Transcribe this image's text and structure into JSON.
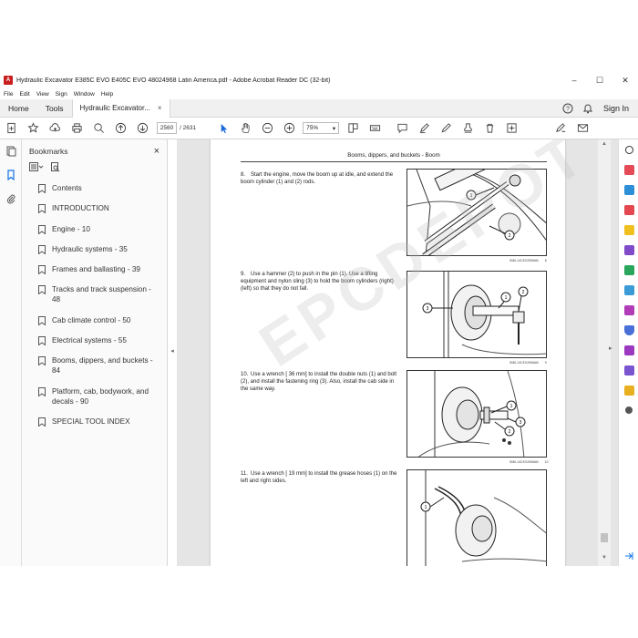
{
  "window": {
    "title": "Hydraulic Excavator E385C EVO E405C EVO 48024968 Latin America.pdf - Adobe Acrobat Reader DC (32-bit)",
    "minimize": "–",
    "maximize": "☐",
    "close": "✕"
  },
  "menu": [
    "File",
    "Edit",
    "View",
    "Sign",
    "Window",
    "Help"
  ],
  "tabs": {
    "home": "Home",
    "tools": "Tools",
    "document": "Hydraulic Excavator...",
    "document_close": "×",
    "sign_in": "Sign In"
  },
  "toolbar": {
    "current_page": "2560",
    "page_total": "/ 2631",
    "zoom": "75%"
  },
  "bookmarks": {
    "title": "Bookmarks",
    "close": "×",
    "items": [
      "Contents",
      "INTRODUCTION",
      "Engine - 10",
      "Hydraulic systems - 35",
      "Frames and ballasting - 39",
      "Tracks and track suspension - 48",
      "Cab climate control - 50",
      "Electrical systems - 55",
      "Booms, dippers, and buckets - 84",
      "Platform, cab, bodywork, and decals - 90",
      "SPECIAL TOOL INDEX"
    ]
  },
  "document": {
    "header": "Booms, dippers, and buckets - Boom",
    "watermark": "EPCDEPOT",
    "steps": [
      {
        "num": "8.",
        "text": "Start the engine, move the boom up at idle, and extend the boom cylinder (1) and (2) rods.",
        "caption": "SMIL14CEX2595AB",
        "fig_no": "8"
      },
      {
        "num": "9.",
        "text": "Use a hammer (2) to push in the pin (1). Use a lifting equipment and nylon sling (3) to hold the boom cylinders (right) (left) so that they do not fall.",
        "caption": "SMIL14CEX2596AB",
        "fig_no": "9"
      },
      {
        "num": "10.",
        "text": "Use a wrench [ 36 mm] to install the double nuts (1) and bolt (2), and install the fastening ring (3). Also, install the cab side in the same way.",
        "caption": "SMIL14CEX2596AB",
        "fig_no": "10"
      },
      {
        "num": "11.",
        "text": "Use a wrench [ 19 mm] to install the grease hoses (1) on the left and right sides.",
        "caption": "",
        "fig_no": ""
      }
    ],
    "callouts": {
      "fig8": [
        "1",
        "2"
      ],
      "fig9": [
        "1",
        "2",
        "3"
      ],
      "fig10": [
        "1",
        "2",
        "3"
      ],
      "fig11": [
        "1"
      ]
    }
  },
  "colors": {
    "accent": "#1473e6",
    "acrobat_red": "#c8201e"
  }
}
